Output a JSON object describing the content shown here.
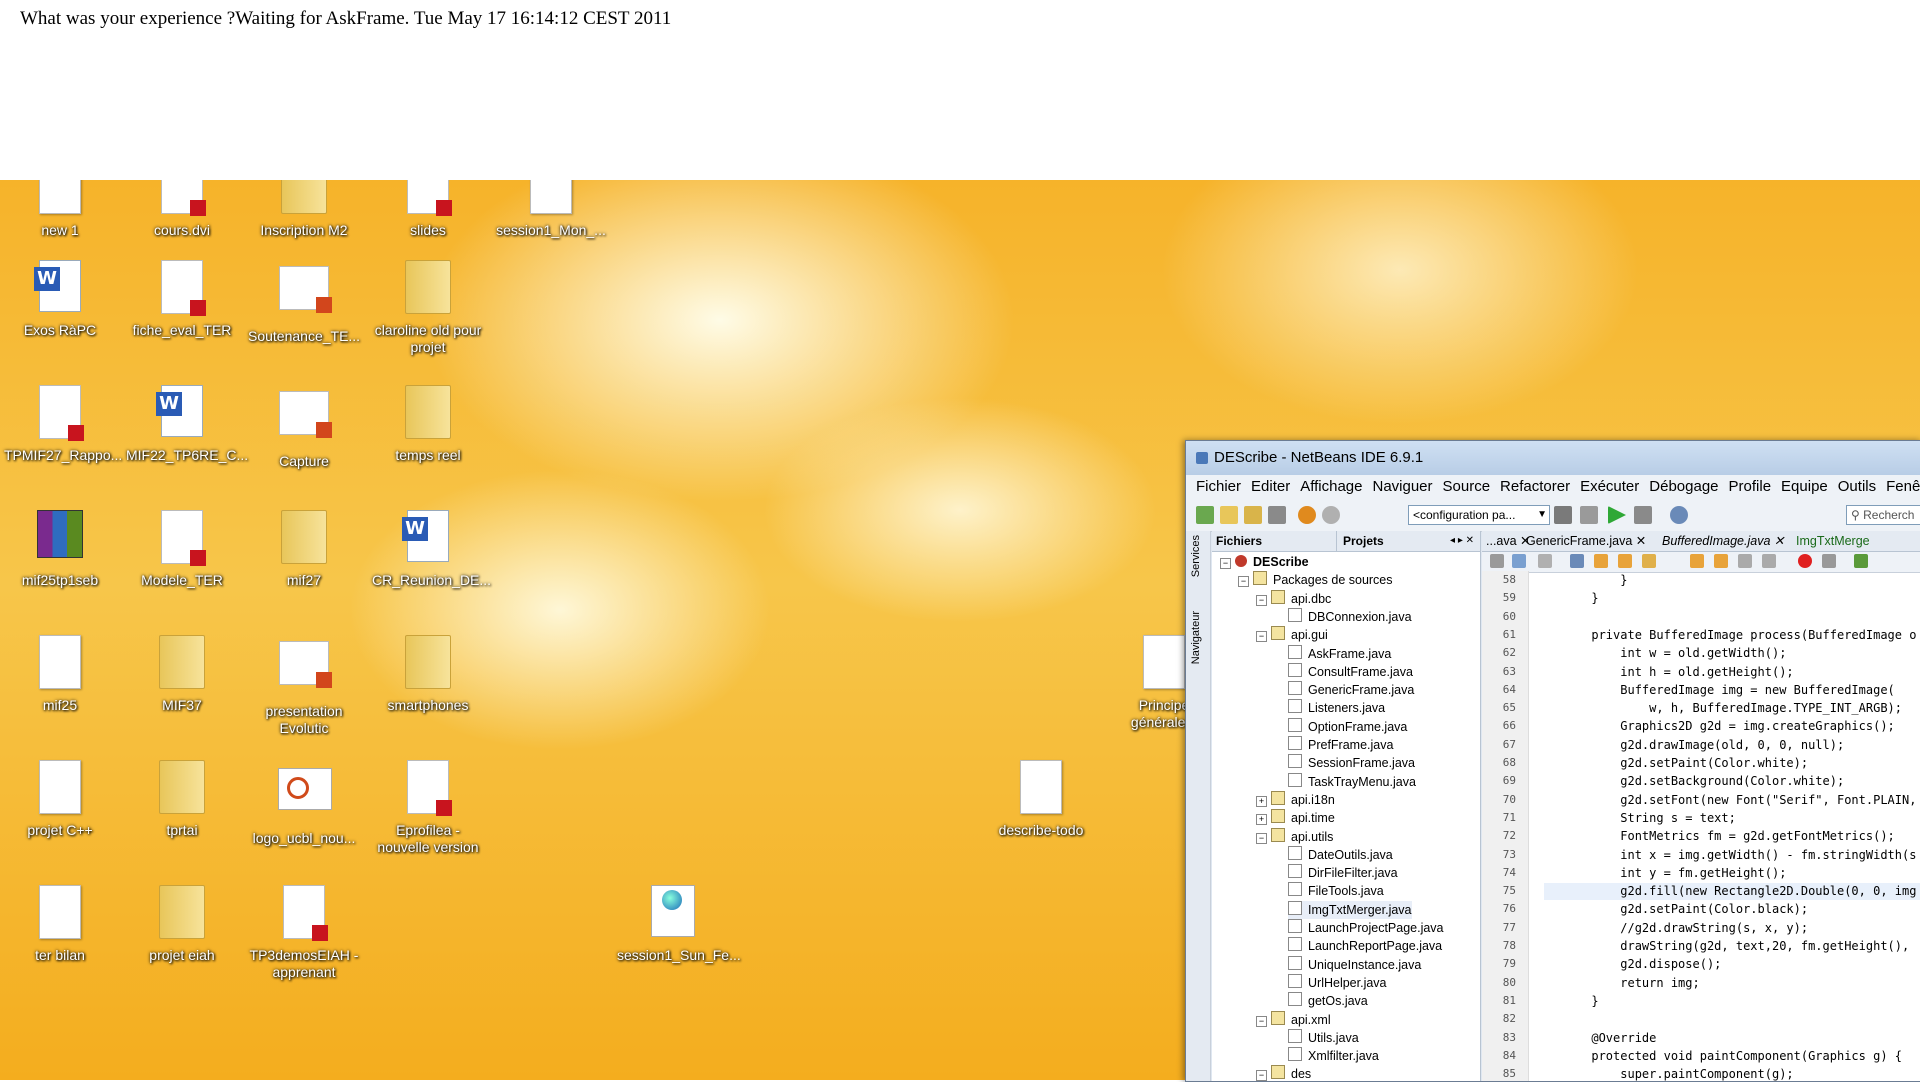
{
  "message": "What was your experience ?Waiting for AskFrame. Tue May 17 16:14:12 CEST 2011",
  "desktop": {
    "icons": [
      {
        "label": "new  1",
        "type": "doc"
      },
      {
        "label": "cours.dvi",
        "type": "pdf"
      },
      {
        "label": "Inscription M2",
        "type": "folder"
      },
      {
        "label": "slides",
        "type": "pdf"
      },
      {
        "label": "session1_Mon_...",
        "type": "doc"
      },
      {
        "label": "Exos RàPC",
        "type": "word"
      },
      {
        "label": "fiche_eval_TER",
        "type": "pdf"
      },
      {
        "label": "Soutenance_TE...",
        "type": "ppt"
      },
      {
        "label": "claroline old pour projet",
        "type": "folder"
      },
      {
        "label": "TPMIF27_Rappo...",
        "type": "pdf"
      },
      {
        "label": "MIF22_TP6RE_C...",
        "type": "word"
      },
      {
        "label": "Capture",
        "type": "ppt"
      },
      {
        "label": "temps reel",
        "type": "folder"
      },
      {
        "label": "mif25tp1seb",
        "type": "rar"
      },
      {
        "label": "Modele_TER",
        "type": "pdf"
      },
      {
        "label": "mif27",
        "type": "folder"
      },
      {
        "label": "CR_Reunion_DE...",
        "type": "word"
      },
      {
        "label": "mif25",
        "type": "doc"
      },
      {
        "label": "MIF37",
        "type": "folder"
      },
      {
        "label": "presentation Evolutic",
        "type": "ppt"
      },
      {
        "label": "smartphones",
        "type": "folder"
      },
      {
        "label": "Principe générale...",
        "type": "doc"
      },
      {
        "label": "projet C++",
        "type": "doc"
      },
      {
        "label": "tprtai",
        "type": "folder"
      },
      {
        "label": "logo_ucbl_nou...",
        "type": "lyon"
      },
      {
        "label": "Eprofilea - nouvelle version",
        "type": "pdf"
      },
      {
        "label": "describe-todo",
        "type": "doc"
      },
      {
        "label": "ter bilan",
        "type": "doc"
      },
      {
        "label": "projet eiah",
        "type": "folder"
      },
      {
        "label": "TP3demosEIAH - apprenant",
        "type": "pdf"
      },
      {
        "label": "session1_Sun_Fe...",
        "type": "web"
      }
    ]
  },
  "netbeans": {
    "title": "DEScribe - NetBeans IDE 6.9.1",
    "menu": [
      "Fichier",
      "Editer",
      "Affichage",
      "Naviguer",
      "Source",
      "Refactorer",
      "Exécuter",
      "Débogage",
      "Profile",
      "Equipe",
      "Outils",
      "Fenêtre"
    ],
    "config_label": "<configuration pa...",
    "search_placeholder": "Recherch",
    "side_tabs": [
      "Services",
      "Navigateur"
    ],
    "tree_tabs": [
      "Fichiers",
      "Projets"
    ],
    "tree": [
      {
        "label": "DEScribe",
        "level": 0,
        "kind": "proj",
        "expander": "−",
        "bold": true
      },
      {
        "label": "Packages de sources",
        "level": 1,
        "kind": "pkgroot",
        "expander": "−"
      },
      {
        "label": "api.dbc",
        "level": 2,
        "kind": "pkg",
        "expander": "−"
      },
      {
        "label": "DBConnexion.java",
        "level": 3,
        "kind": "java"
      },
      {
        "label": "api.gui",
        "level": 2,
        "kind": "pkg",
        "expander": "−"
      },
      {
        "label": "AskFrame.java",
        "level": 3,
        "kind": "java"
      },
      {
        "label": "ConsultFrame.java",
        "level": 3,
        "kind": "java"
      },
      {
        "label": "GenericFrame.java",
        "level": 3,
        "kind": "java"
      },
      {
        "label": "Listeners.java",
        "level": 3,
        "kind": "java"
      },
      {
        "label": "OptionFrame.java",
        "level": 3,
        "kind": "java"
      },
      {
        "label": "PrefFrame.java",
        "level": 3,
        "kind": "java"
      },
      {
        "label": "SessionFrame.java",
        "level": 3,
        "kind": "java"
      },
      {
        "label": "TaskTrayMenu.java",
        "level": 3,
        "kind": "java"
      },
      {
        "label": "api.i18n",
        "level": 2,
        "kind": "pkg",
        "expander": "+"
      },
      {
        "label": "api.time",
        "level": 2,
        "kind": "pkg",
        "expander": "+"
      },
      {
        "label": "api.utils",
        "level": 2,
        "kind": "pkg",
        "expander": "−"
      },
      {
        "label": "DateOutils.java",
        "level": 3,
        "kind": "java"
      },
      {
        "label": "DirFileFilter.java",
        "level": 3,
        "kind": "java"
      },
      {
        "label": "FileTools.java",
        "level": 3,
        "kind": "java"
      },
      {
        "label": "ImgTxtMerger.java",
        "level": 3,
        "kind": "java",
        "selected": true
      },
      {
        "label": "LaunchProjectPage.java",
        "level": 3,
        "kind": "java"
      },
      {
        "label": "LaunchReportPage.java",
        "level": 3,
        "kind": "java"
      },
      {
        "label": "UniqueInstance.java",
        "level": 3,
        "kind": "java"
      },
      {
        "label": "UrlHelper.java",
        "level": 3,
        "kind": "java"
      },
      {
        "label": "getOs.java",
        "level": 3,
        "kind": "java"
      },
      {
        "label": "api.xml",
        "level": 2,
        "kind": "pkg",
        "expander": "−"
      },
      {
        "label": "Utils.java",
        "level": 3,
        "kind": "java"
      },
      {
        "label": "Xmlfilter.java",
        "level": 3,
        "kind": "java"
      },
      {
        "label": "des",
        "level": 2,
        "kind": "pkg",
        "expander": "−"
      }
    ],
    "editor_tabs": [
      {
        "label": "...ava"
      },
      {
        "label": "GenericFrame.java"
      },
      {
        "label": "BufferedImage.java",
        "italic": true
      },
      {
        "label": "ImgTxtMerge",
        "active": true
      }
    ],
    "code_lines": [
      {
        "n": "58",
        "text": "          }"
      },
      {
        "n": "59",
        "text": "      }"
      },
      {
        "n": "60",
        "text": ""
      },
      {
        "n": "61",
        "text": "      private BufferedImage process(BufferedImage o"
      },
      {
        "n": "62",
        "text": "          int w = old.getWidth();"
      },
      {
        "n": "63",
        "text": "          int h = old.getHeight();"
      },
      {
        "n": "64",
        "text": "          BufferedImage img = new BufferedImage("
      },
      {
        "n": "65",
        "text": "              w, h, BufferedImage.TYPE_INT_ARGB);"
      },
      {
        "n": "66",
        "text": "          Graphics2D g2d = img.createGraphics();"
      },
      {
        "n": "67",
        "text": "          g2d.drawImage(old, 0, 0, null);"
      },
      {
        "n": "68",
        "text": "          g2d.setPaint(Color.white);"
      },
      {
        "n": "69",
        "text": "          g2d.setBackground(Color.white);"
      },
      {
        "n": "70",
        "text": "          g2d.setFont(new Font(\"Serif\", Font.PLAIN,"
      },
      {
        "n": "71",
        "text": "          String s = text;"
      },
      {
        "n": "72",
        "text": "          FontMetrics fm = g2d.getFontMetrics();"
      },
      {
        "n": "73",
        "text": "          int x = img.getWidth() - fm.stringWidth(s"
      },
      {
        "n": "74",
        "text": "          int y = fm.getHeight();"
      },
      {
        "n": "75",
        "text": "          g2d.fill(new Rectangle2D.Double(0, 0, img"
      },
      {
        "n": "76",
        "text": "          g2d.setPaint(Color.black);"
      },
      {
        "n": "77",
        "text": "          //g2d.drawString(s, x, y);"
      },
      {
        "n": "78",
        "text": "          drawString(g2d, text,20, fm.getHeight(),"
      },
      {
        "n": "79",
        "text": "          g2d.dispose();"
      },
      {
        "n": "80",
        "text": "          return img;"
      },
      {
        "n": "81",
        "text": "      }"
      },
      {
        "n": "82",
        "text": ""
      },
      {
        "n": "83",
        "text": "      @Override"
      },
      {
        "n": "84",
        "text": "      protected void paintComponent(Graphics g) {"
      },
      {
        "n": "85",
        "text": "          super.paintComponent(g);"
      }
    ]
  }
}
